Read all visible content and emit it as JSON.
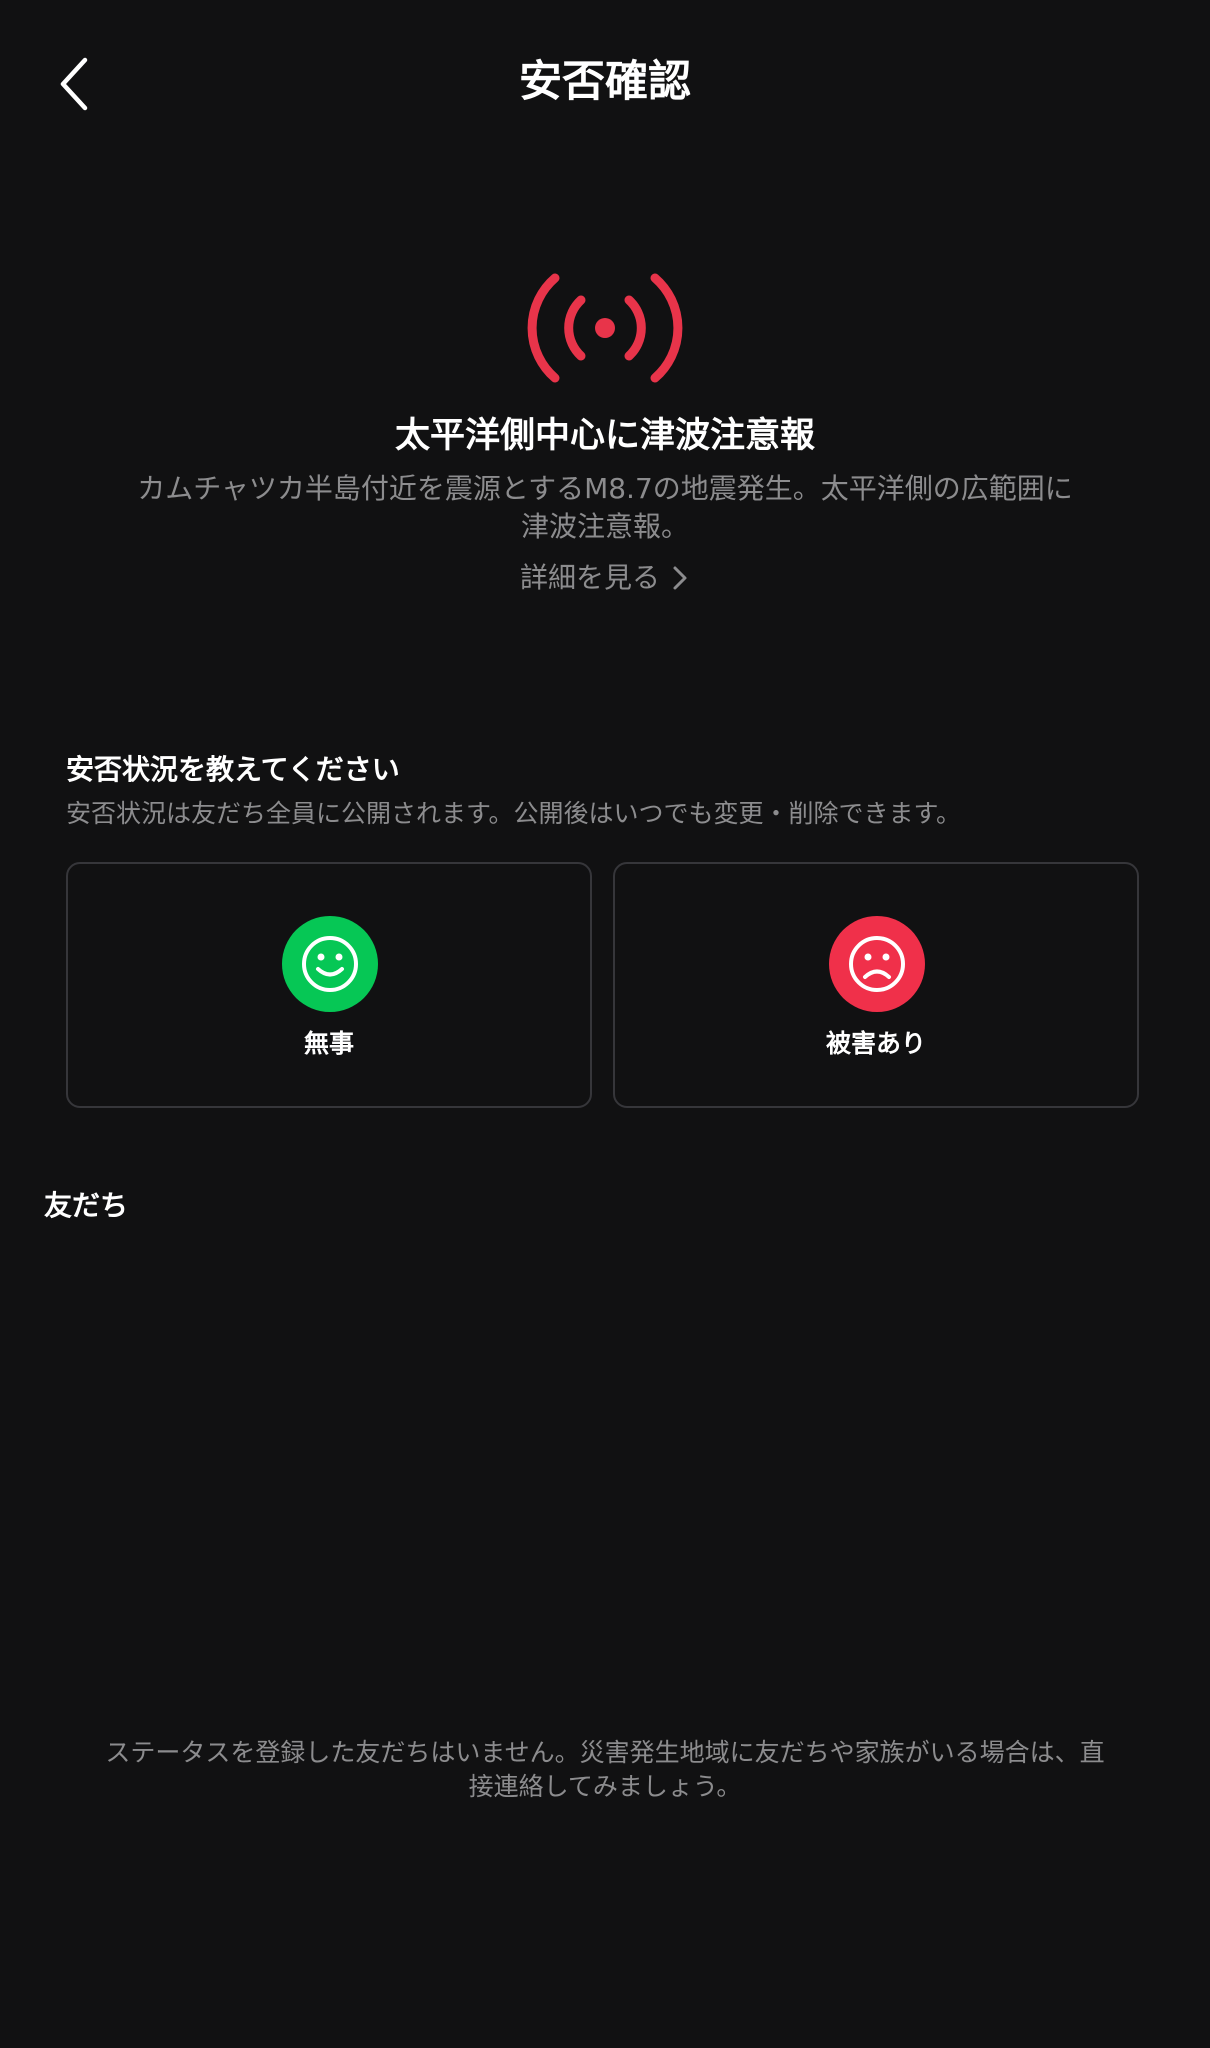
{
  "header": {
    "title": "安否確認",
    "back_icon": "chevron-left-icon"
  },
  "alert": {
    "icon": "broadcast-icon",
    "icon_color": "#e8344a",
    "title": "太平洋側中心に津波注意報",
    "description": "カムチャツカ半島付近を震源とするM8.7の地震発生。太平洋側の広範囲に津波注意報。",
    "detail_link": "詳細を見る"
  },
  "status_section": {
    "title": "安否状況を教えてください",
    "description": "安否状況は友だち全員に公開されます。公開後はいつでも変更・削除できます。",
    "options": [
      {
        "label": "無事",
        "icon": "smile-icon",
        "color": "#06c755"
      },
      {
        "label": "被害あり",
        "icon": "frown-icon",
        "color": "#f0304a"
      }
    ]
  },
  "friends_section": {
    "title": "友だち",
    "empty_message": "ステータスを登録した友だちはいません。災害発生地域に友だちや家族がいる場合は、直接連絡してみましょう。"
  }
}
